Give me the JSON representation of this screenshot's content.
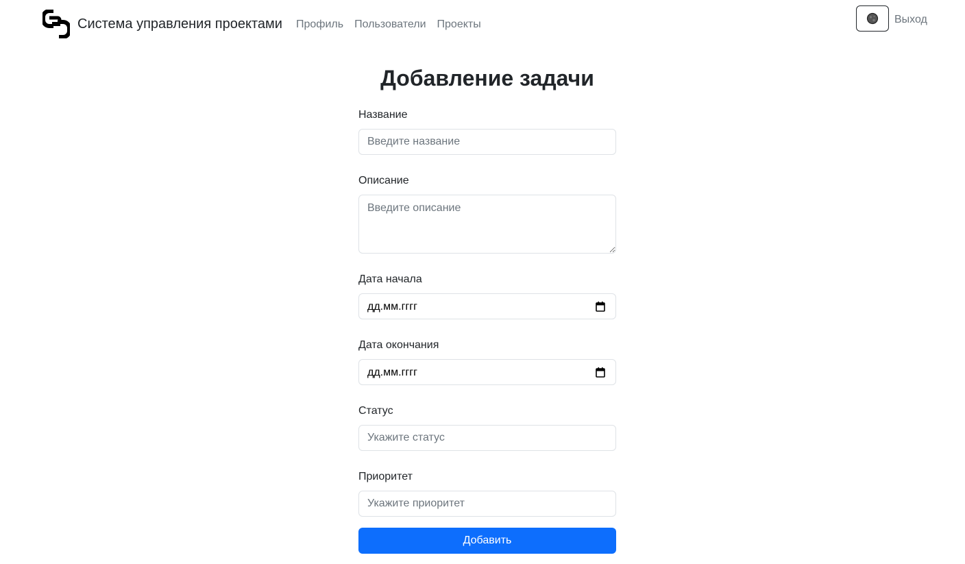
{
  "navbar": {
    "brand_text": "Система управления проектами",
    "links": [
      {
        "label": "Профиль"
      },
      {
        "label": "Пользователи"
      },
      {
        "label": "Проекты"
      }
    ],
    "theme_toggle_icon": "theme-toggle-icon",
    "logout_label": "Выход"
  },
  "form": {
    "title": "Добавление задачи",
    "name": {
      "label": "Название",
      "placeholder": "Введите название"
    },
    "description": {
      "label": "Описание",
      "placeholder": "Введите описание"
    },
    "start_date": {
      "label": "Дата начала",
      "value": "дд.мм.гггг"
    },
    "end_date": {
      "label": "Дата окончания",
      "value": "дд.мм.гггг"
    },
    "status": {
      "label": "Статус",
      "placeholder": "Укажите статус"
    },
    "priority": {
      "label": "Приоритет",
      "placeholder": "Укажите приоритет"
    },
    "submit_label": "Добавить"
  },
  "colors": {
    "primary": "#0d6efd",
    "text": "#212529",
    "muted": "#6c757d",
    "border": "#dee2e6"
  }
}
